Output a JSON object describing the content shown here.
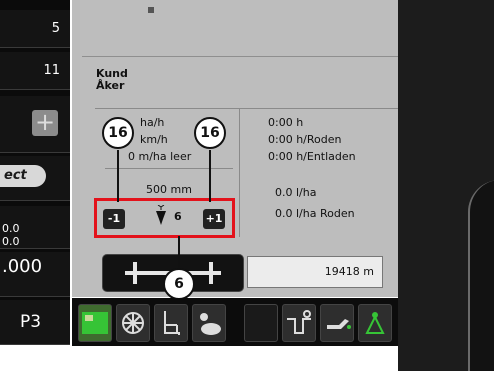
{
  "left_panel": {
    "row_values": [
      "5",
      "11"
    ],
    "logo_text": "ect",
    "readout_top": "0.0",
    "readout_bottom": "0.0",
    "decimal_value": ".000",
    "gear_label": "P3"
  },
  "customer": {
    "name": "Kund",
    "field": "Åker"
  },
  "stats_left": {
    "line1": "ha/h",
    "line2": "km/h",
    "line3": "0 m/ha leer",
    "width": "500 mm"
  },
  "stats_right": {
    "line1": "0:00 h",
    "line2": "0:00 h/Roden",
    "line3": "0:00 h/Entladen",
    "rate1": "0.0 l/ha",
    "rate2": "0.0 l/ha Roden"
  },
  "section_control": {
    "minus_label": "-1",
    "plus_label": "+1",
    "position_value": "6"
  },
  "callouts": {
    "left_label": "16",
    "right_label": "16",
    "bottom_label": "6"
  },
  "distance_field": {
    "value": "19418 m"
  },
  "toolbar": {
    "icons": [
      "field-overview-icon",
      "rotor-icon",
      "seat-icon",
      "slow-speed-icon",
      "blank-icon",
      "transmission-icon",
      "oil-can-icon",
      "antenna-icon"
    ]
  },
  "colors": {
    "highlight_red": "#e3121b",
    "panel_gray": "#bdbdbd",
    "bezel_black": "#1c1c1c",
    "icon_green": "#36c436"
  }
}
